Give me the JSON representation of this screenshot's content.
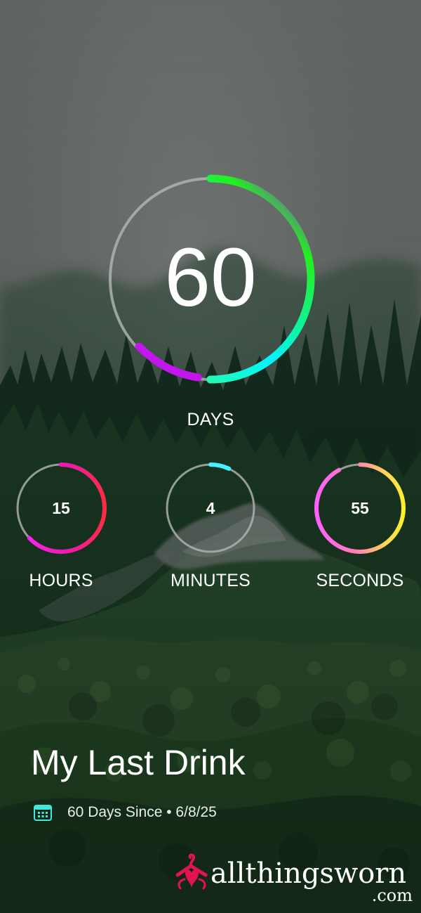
{
  "background": {
    "scene_icon": "misty-forest-hillside-photo",
    "sky_color": "#626765",
    "forest_color": "#173623",
    "grass_color": "#315331"
  },
  "counter": {
    "days": {
      "value": "60",
      "label": "DAYS",
      "progress_fraction": 0.5,
      "colors": [
        "#b400ff",
        "#23f021",
        "#00f5ff",
        "#4fff57"
      ]
    },
    "hours": {
      "value": "15",
      "label": "HOURS",
      "progress_fraction": 0.63,
      "colors": [
        "#ff2b45",
        "#f018b0",
        "#ff25ff"
      ]
    },
    "minutes": {
      "value": "4",
      "label": "MINUTES",
      "progress_fraction": 0.07,
      "colors": [
        "#34e9e0",
        "#48f1ff"
      ]
    },
    "seconds": {
      "value": "55",
      "label": "SECONDS",
      "progress_fraction": 0.92,
      "colors": [
        "#ff5fff",
        "#ff7db8",
        "#ffd65b",
        "#fff02b"
      ]
    }
  },
  "title": "My Last Drink",
  "meta": {
    "calendar_icon": "calendar-icon",
    "text": "60 Days Since • 6/8/25"
  },
  "watermark": {
    "logo_icon": "clothes-hanger-heart-icon",
    "main": "allthingsworn",
    "domain": ".com",
    "accent": "#e0144e"
  }
}
